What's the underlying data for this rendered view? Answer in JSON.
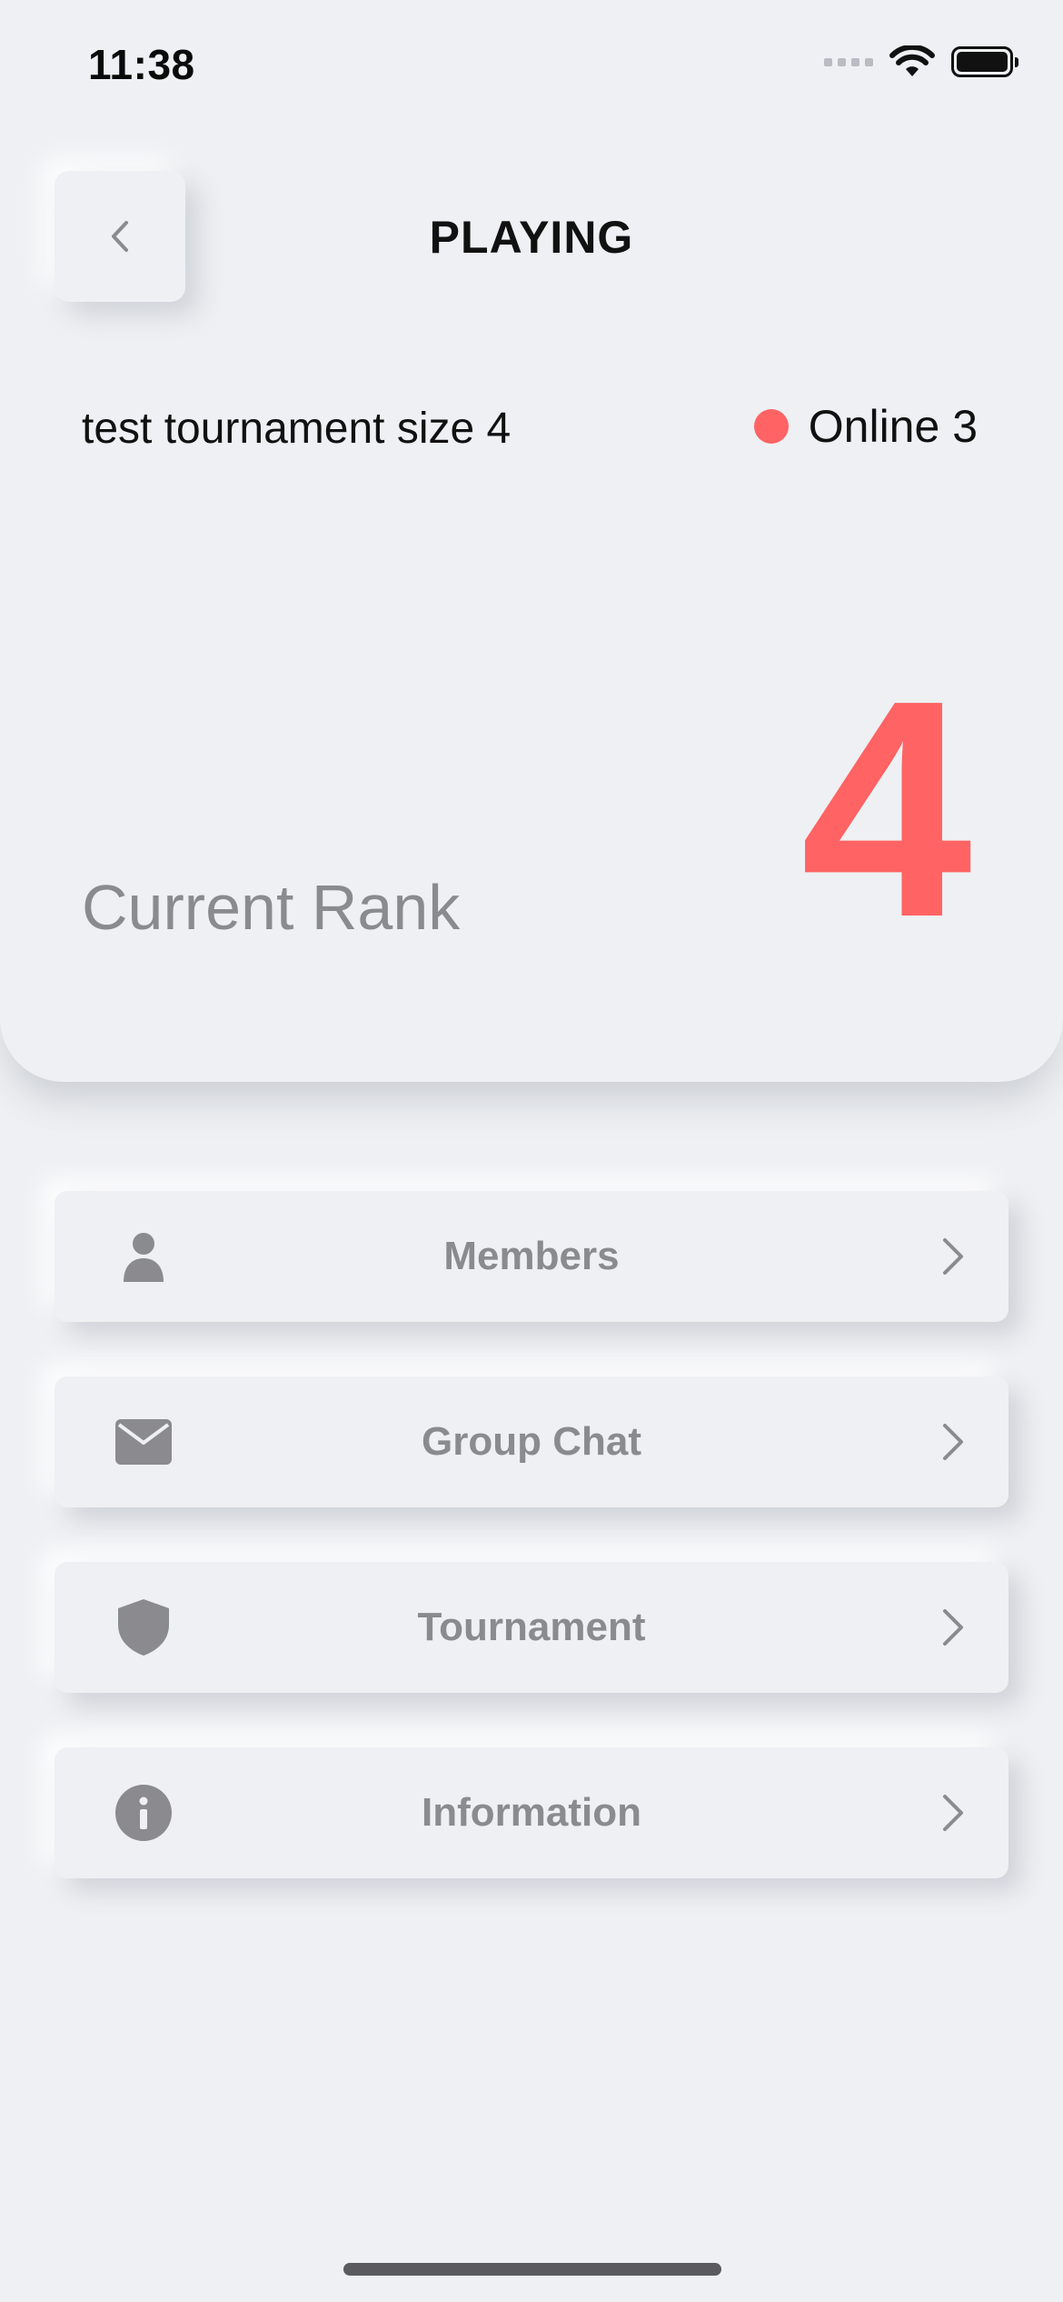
{
  "status_bar": {
    "time": "11:38"
  },
  "header": {
    "title": "PLAYING"
  },
  "tournament": {
    "name": "test tournament size 4",
    "online_label": "Online 3"
  },
  "rank": {
    "label": "Current Rank",
    "value": "4"
  },
  "menu": [
    {
      "label": "Members",
      "icon": "person-icon"
    },
    {
      "label": "Group Chat",
      "icon": "envelope-icon"
    },
    {
      "label": "Tournament",
      "icon": "shield-icon"
    },
    {
      "label": "Information",
      "icon": "info-icon"
    }
  ],
  "colors": {
    "accent": "#ff6363",
    "muted": "#8a8a8f",
    "background": "#eef0f3"
  }
}
